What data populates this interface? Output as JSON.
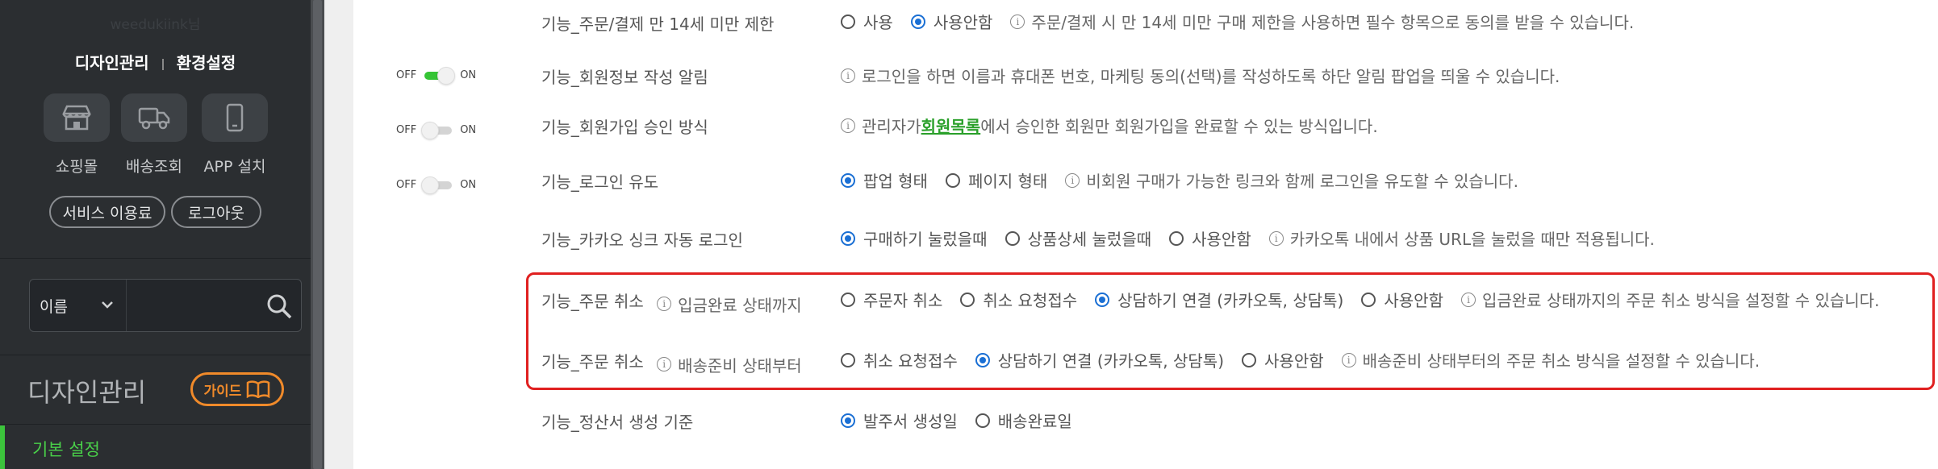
{
  "sidebar": {
    "user_name": "weedukiink님",
    "top_links": [
      "디자인관리",
      "환경설정"
    ],
    "quick_icons": [
      {
        "label": "쇼핑몰",
        "icon": "store-icon"
      },
      {
        "label": "배송조회",
        "icon": "truck-icon"
      },
      {
        "label": "APP 설치",
        "icon": "phone-icon"
      }
    ],
    "pill_buttons": [
      "서비스 이용료",
      "로그아웃"
    ],
    "search": {
      "select_value": "이름",
      "placeholder": ""
    },
    "section_title": "디자인관리",
    "guide_label": "가이드",
    "active_menu": "기본 설정"
  },
  "main": {
    "rows": [
      {
        "label": "기능_주문/결제 만 14세 미만 제한",
        "options": [
          {
            "label": "사용",
            "checked": false
          },
          {
            "label": "사용안함",
            "checked": true
          }
        ],
        "info": "주문/결제 시 만 14세 미만 구매 제한을 사용하면 필수 항목으로 동의를 받을 수 있습니다."
      },
      {
        "toggle": {
          "off": "OFF",
          "on": "ON",
          "state": "on"
        },
        "label": "기능_회원정보 작성 알림",
        "info": "로그인을 하면 이름과 휴대폰 번호, 마케팅 동의(선택)를 작성하도록 하단 알림 팝업을 띄울 수 있습니다."
      },
      {
        "toggle": {
          "off": "OFF",
          "on": "ON",
          "state": "off"
        },
        "label": "기능_회원가입 승인 방식",
        "info_pre": "관리자가 ",
        "info_link": "회원목록",
        "info_post": "에서 승인한 회원만 회원가입을 완료할 수 있는 방식입니다."
      },
      {
        "toggle": {
          "off": "OFF",
          "on": "ON",
          "state": "off"
        },
        "label": "기능_로그인 유도",
        "options": [
          {
            "label": "팝업 형태",
            "checked": true
          },
          {
            "label": "페이지 형태",
            "checked": false
          }
        ],
        "info": "비회원 구매가 가능한 링크와 함께 로그인을 유도할 수 있습니다."
      },
      {
        "label": "기능_카카오 싱크 자동 로그인",
        "options": [
          {
            "label": "구매하기 눌렀을때",
            "checked": true
          },
          {
            "label": "상품상세 눌렀을때",
            "checked": false
          },
          {
            "label": "사용안함",
            "checked": false
          }
        ],
        "info": "카카오톡 내에서 상품 URL을 눌렀을 때만 적용됩니다."
      },
      {
        "label": "기능_주문 취소",
        "sub": "입금완료 상태까지",
        "options": [
          {
            "label": "주문자 취소",
            "checked": false
          },
          {
            "label": "취소 요청접수",
            "checked": false
          },
          {
            "label": "상담하기 연결 (카카오톡, 상담톡)",
            "checked": true
          },
          {
            "label": "사용안함",
            "checked": false
          }
        ],
        "info": "입금완료 상태까지의 주문 취소 방식을 설정할 수 있습니다."
      },
      {
        "label": "기능_주문 취소",
        "sub": "배송준비 상태부터",
        "options": [
          {
            "label": "취소 요청접수",
            "checked": false
          },
          {
            "label": "상담하기 연결 (카카오톡, 상담톡)",
            "checked": true
          },
          {
            "label": "사용안함",
            "checked": false
          }
        ],
        "info": "배송준비 상태부터의 주문 취소 방식을 설정할 수 있습니다."
      },
      {
        "label": "기능_정산서 생성 기준",
        "options": [
          {
            "label": "발주서 생성일",
            "checked": true
          },
          {
            "label": "배송완료일",
            "checked": false
          }
        ]
      }
    ]
  },
  "colors": {
    "accent_blue": "#1a6fd4",
    "green": "#35c435",
    "highlight_red": "#e02020",
    "guide_orange": "#f08a2a"
  }
}
